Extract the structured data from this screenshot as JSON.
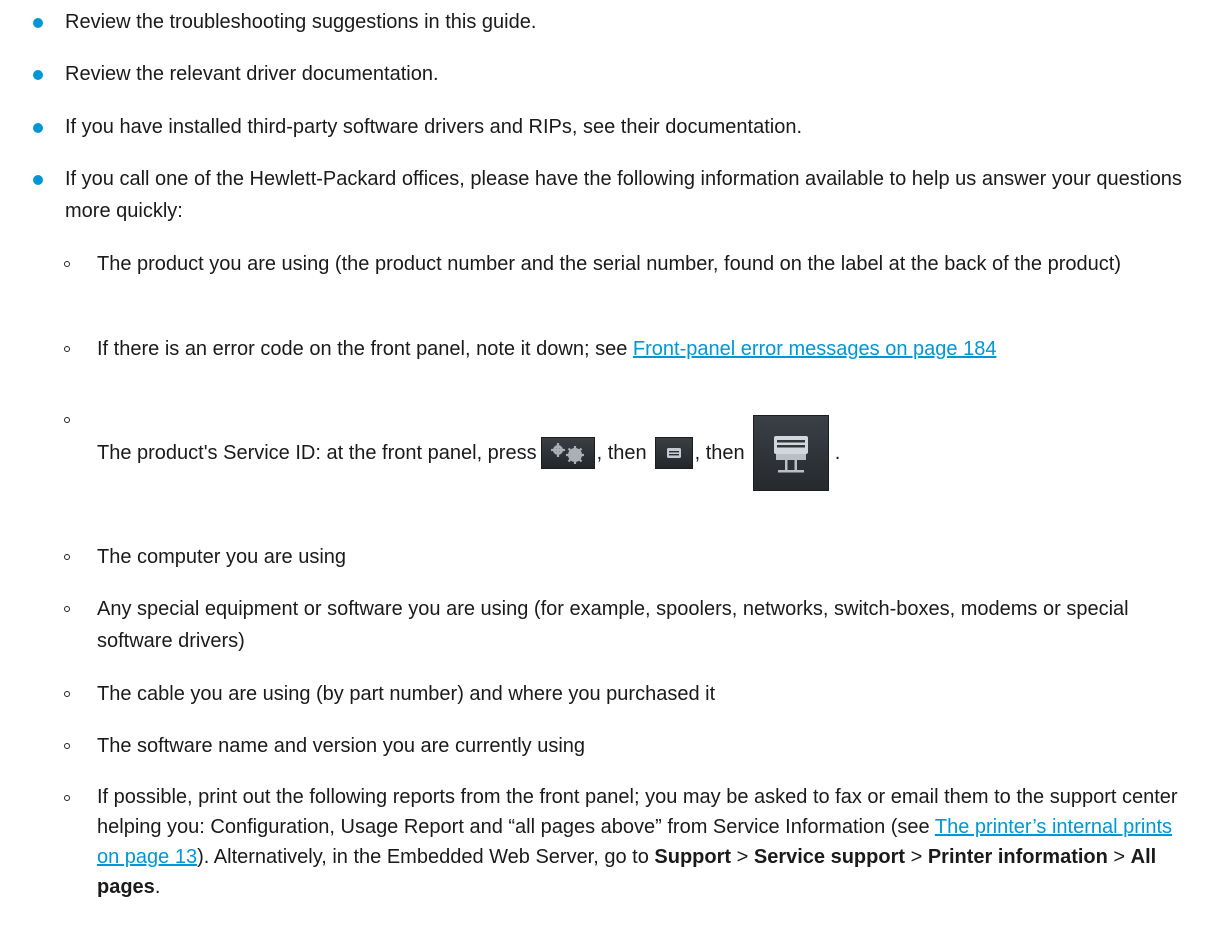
{
  "bullets": [
    {
      "text": "Review the troubleshooting suggestions in this guide."
    },
    {
      "text": "Review the relevant driver documentation."
    },
    {
      "text": "If you have installed third-party software drivers and RIPs, see their documentation."
    },
    {
      "text": "If you call one of the Hewlett-Packard offices, please have the following information available to help us answer your questions more quickly:"
    }
  ],
  "sub": {
    "product": "The product you are using (the product number and the serial number, found on the label at the back of the product)",
    "error_pre": "If there is an error code on the front panel, note it down; see ",
    "error_link": "Front-panel error messages on page 184",
    "service_id": {
      "pre": "The product's Service ID: at the front panel, press",
      "then1": ", then",
      "then2": ", then",
      "end": ".",
      "icons": [
        "settings-gear-icon",
        "printer-small-icon",
        "printer-large-icon"
      ]
    },
    "computer": "The computer you are using",
    "equipment": "Any special equipment or software you are using (for example, spoolers, networks, switch-boxes, modems or special software drivers)",
    "cable": "The cable you are using (by part number) and where you purchased it",
    "software": "The software name and version you are currently using",
    "reports": {
      "pre": "If possible, print out the following reports from the front panel; you may be asked to fax or email them to the support center helping you: Configuration, Usage Report and “all pages above” from Service Information (see ",
      "link": "The printer’s internal prints on page 13",
      "mid": "). Alternatively, in the Embedded Web Server, go to ",
      "b1": "Support",
      "sep1": " > ",
      "b2": "Service support",
      "sep2": " > ",
      "b3": "Printer information",
      "sep3": " > ",
      "b4": "All pages",
      "end": "."
    }
  },
  "colors": {
    "bullet": "#0096d6",
    "link": "#0096d6",
    "text": "#1a1a1a",
    "button_bg": "#2e3236"
  }
}
